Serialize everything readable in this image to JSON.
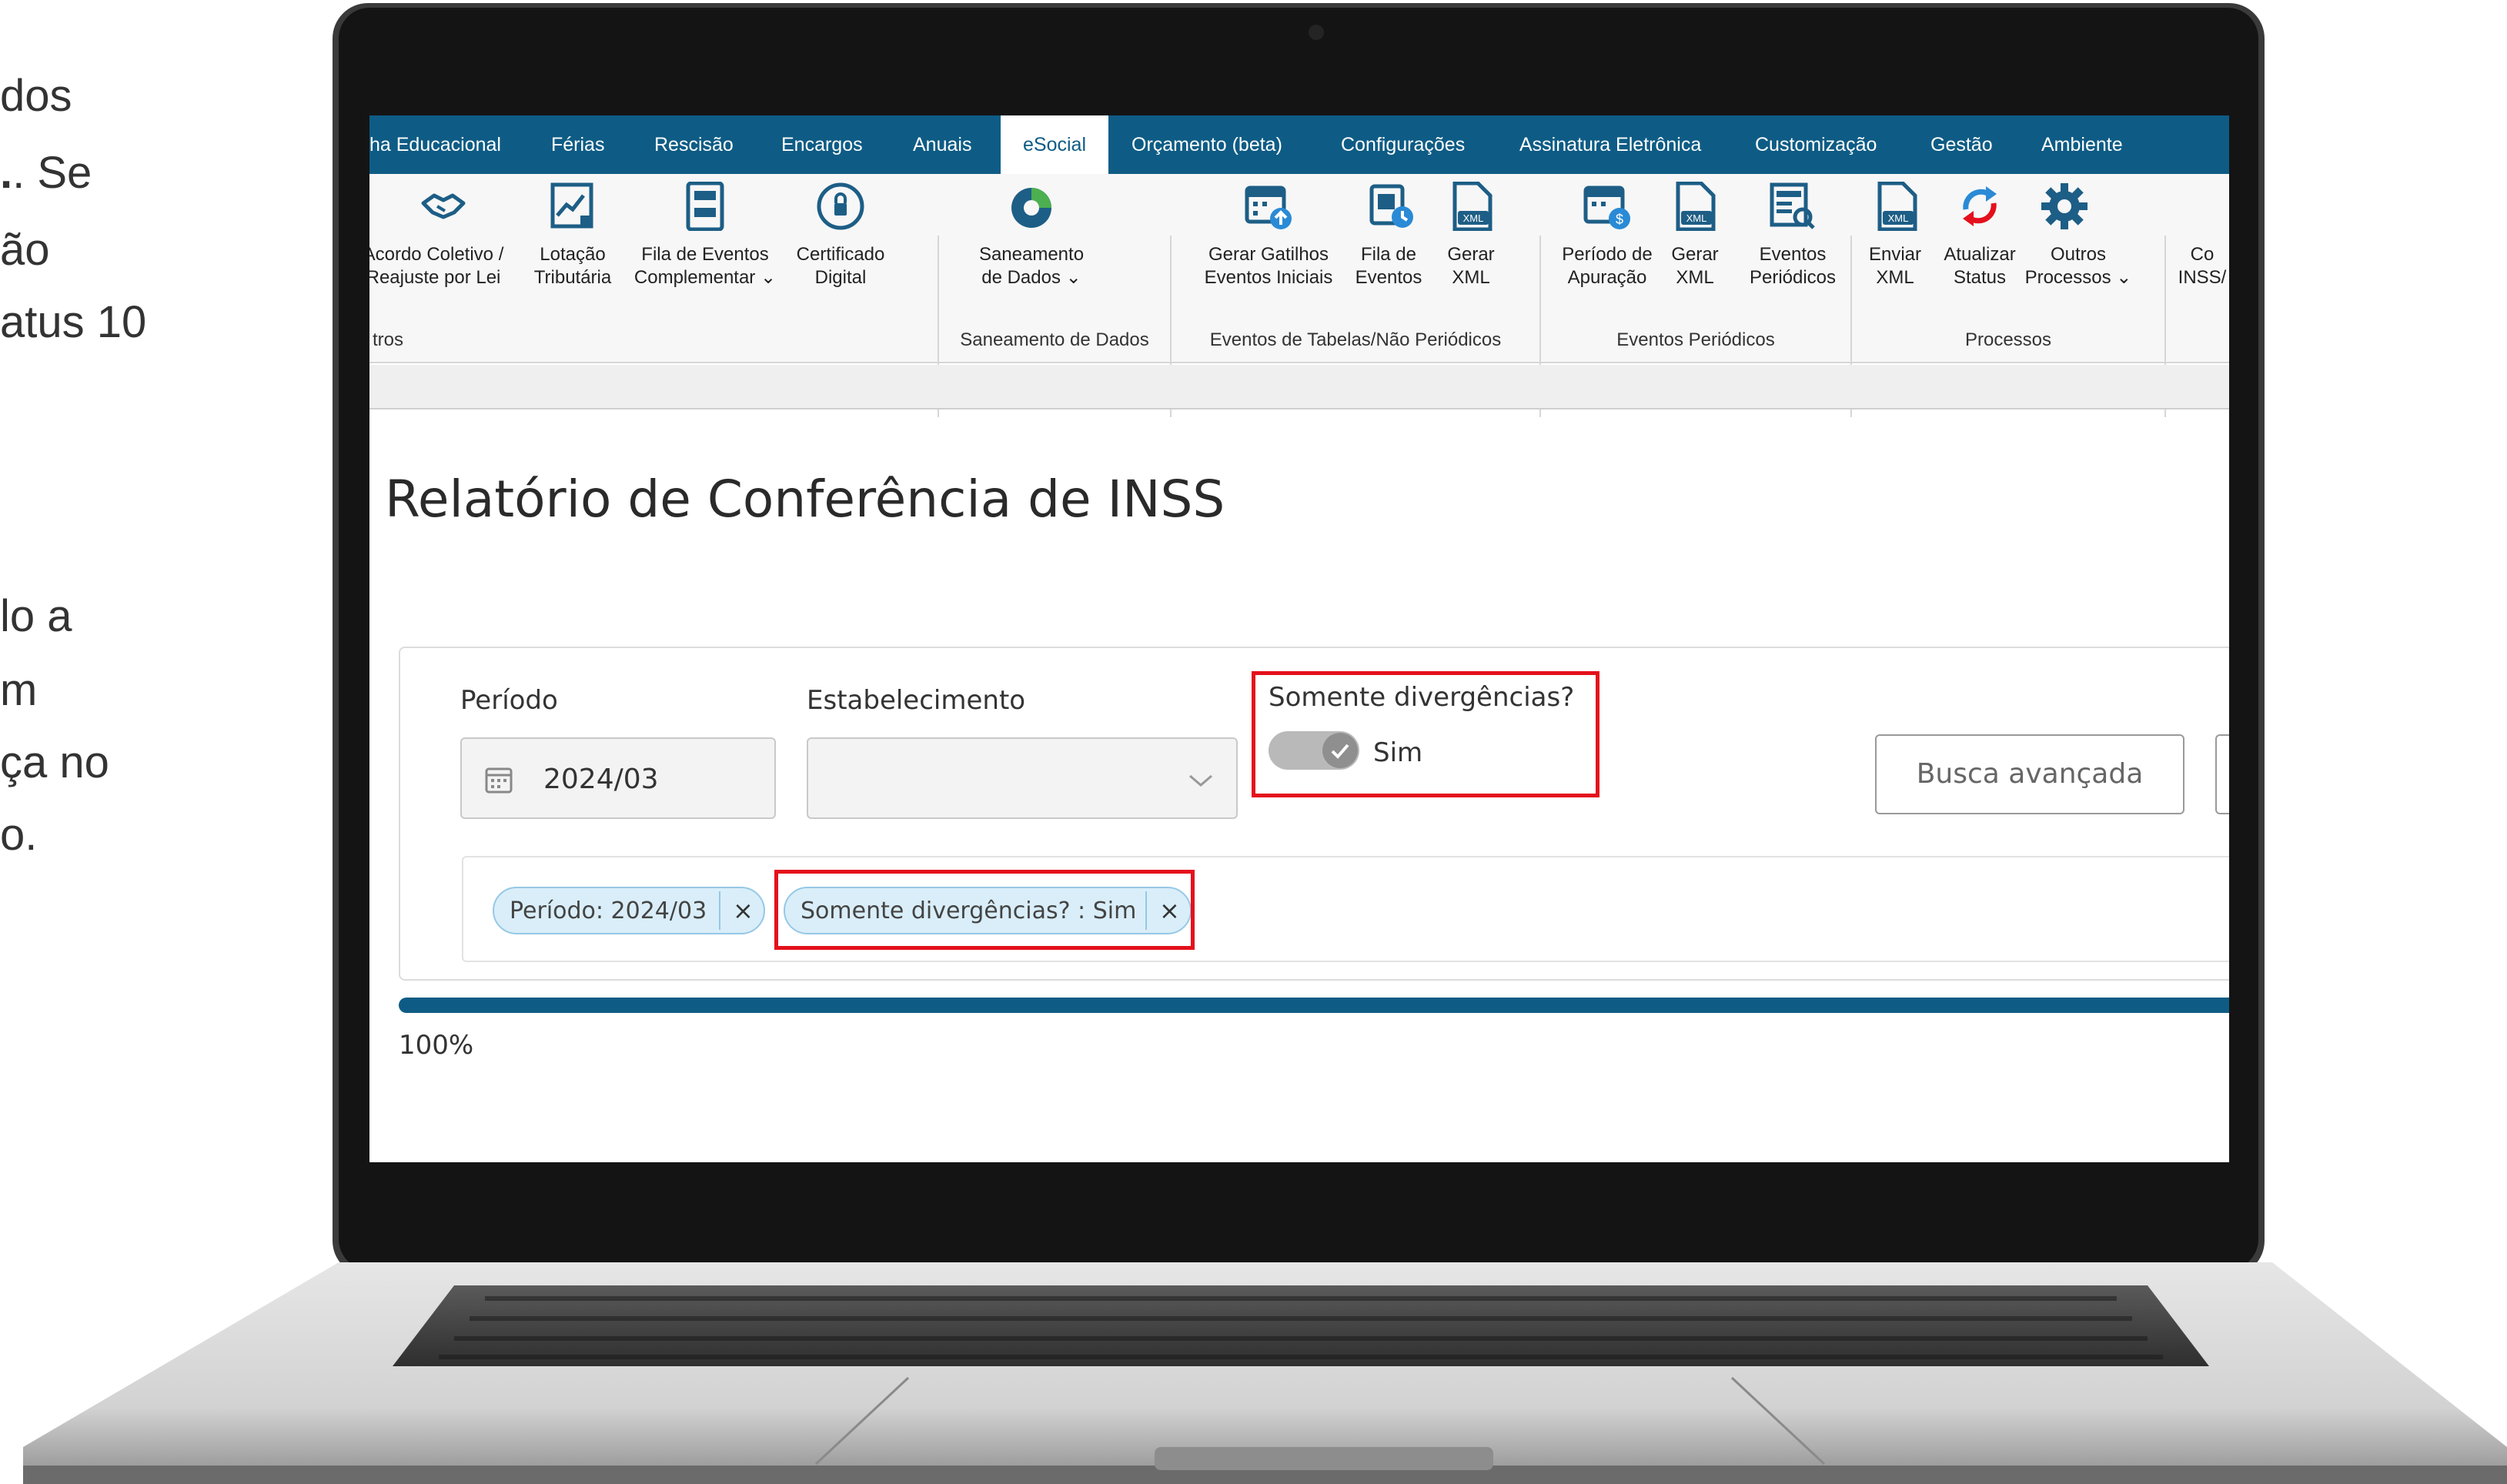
{
  "left_fragments": [
    "dos",
    ". Se",
    "ão",
    "atus 10",
    "lo a",
    "m",
    "ça no",
    "o."
  ],
  "menu": {
    "tabs": [
      "ha Educacional",
      "Férias",
      "Rescisão",
      "Encargos",
      "Anuais",
      "eSocial",
      "Orçamento (beta)",
      "Configurações",
      "Assinatura Eletrônica",
      "Customização",
      "Gestão",
      "Ambiente"
    ],
    "active_tab": "eSocial"
  },
  "ribbon": {
    "items": [
      {
        "line1": "Acordo Coletivo /",
        "line2": "Reajuste por Lei",
        "icon": "handshake-icon"
      },
      {
        "line1": "Lotação",
        "line2": "Tributária",
        "icon": "chart-line-icon"
      },
      {
        "line1": "Fila de Eventos",
        "line2": "Complementar ⌄",
        "icon": "queue-list-icon"
      },
      {
        "line1": "Certificado",
        "line2": "Digital",
        "icon": "lock-icon"
      },
      {
        "line1": "Saneamento",
        "line2": "de Dados ⌄",
        "icon": "pie-chart-icon"
      },
      {
        "line1": "Gerar Gatilhos",
        "line2": "Eventos Iniciais",
        "icon": "calendar-upload-icon"
      },
      {
        "line1": "Fila de",
        "line2": "Eventos",
        "icon": "event-queue-icon"
      },
      {
        "line1": "Gerar",
        "line2": "XML",
        "icon": "xml-file-icon"
      },
      {
        "line1": "Período de",
        "line2": "Apuração",
        "icon": "calendar-money-icon"
      },
      {
        "line1": "Gerar",
        "line2": "XML",
        "icon": "xml-file-icon"
      },
      {
        "line1": "Eventos",
        "line2": "Periódicos",
        "icon": "periodic-events-icon"
      },
      {
        "line1": "Enviar",
        "line2": "XML",
        "icon": "xml-send-icon"
      },
      {
        "line1": "Atualizar",
        "line2": "Status",
        "icon": "refresh-icon"
      },
      {
        "line1": "Outros",
        "line2": "Processos ⌄",
        "icon": "gear-icon"
      },
      {
        "line1": "Co",
        "line2": "INSS/",
        "icon": ""
      }
    ],
    "groups": [
      "tros",
      "Saneamento de Dados",
      "Eventos de Tabelas/Não Periódicos",
      "Eventos Periódicos",
      "Processos"
    ]
  },
  "page": {
    "title": "Relatório de Conferência de INSS"
  },
  "filters": {
    "periodo_label": "Período",
    "periodo_value": "2024/03",
    "estabelecimento_label": "Estabelecimento",
    "estabelecimento_value": "",
    "divergencias_label": "Somente divergências?",
    "divergencias_value": "Sim",
    "divergencias_on": true,
    "busca_button": "Busca avançada"
  },
  "chips": [
    {
      "label": "Período: 2024/03",
      "remove": "×"
    },
    {
      "label": "Somente divergências? : Sim",
      "remove": "×"
    }
  ],
  "progress": {
    "value": 1.0,
    "label": "100%"
  },
  "colors": {
    "menubar": "#0e5c85",
    "highlight": "#e4101c",
    "chip_bg": "#d9eef9",
    "icon_blue": "#1d5e86"
  }
}
